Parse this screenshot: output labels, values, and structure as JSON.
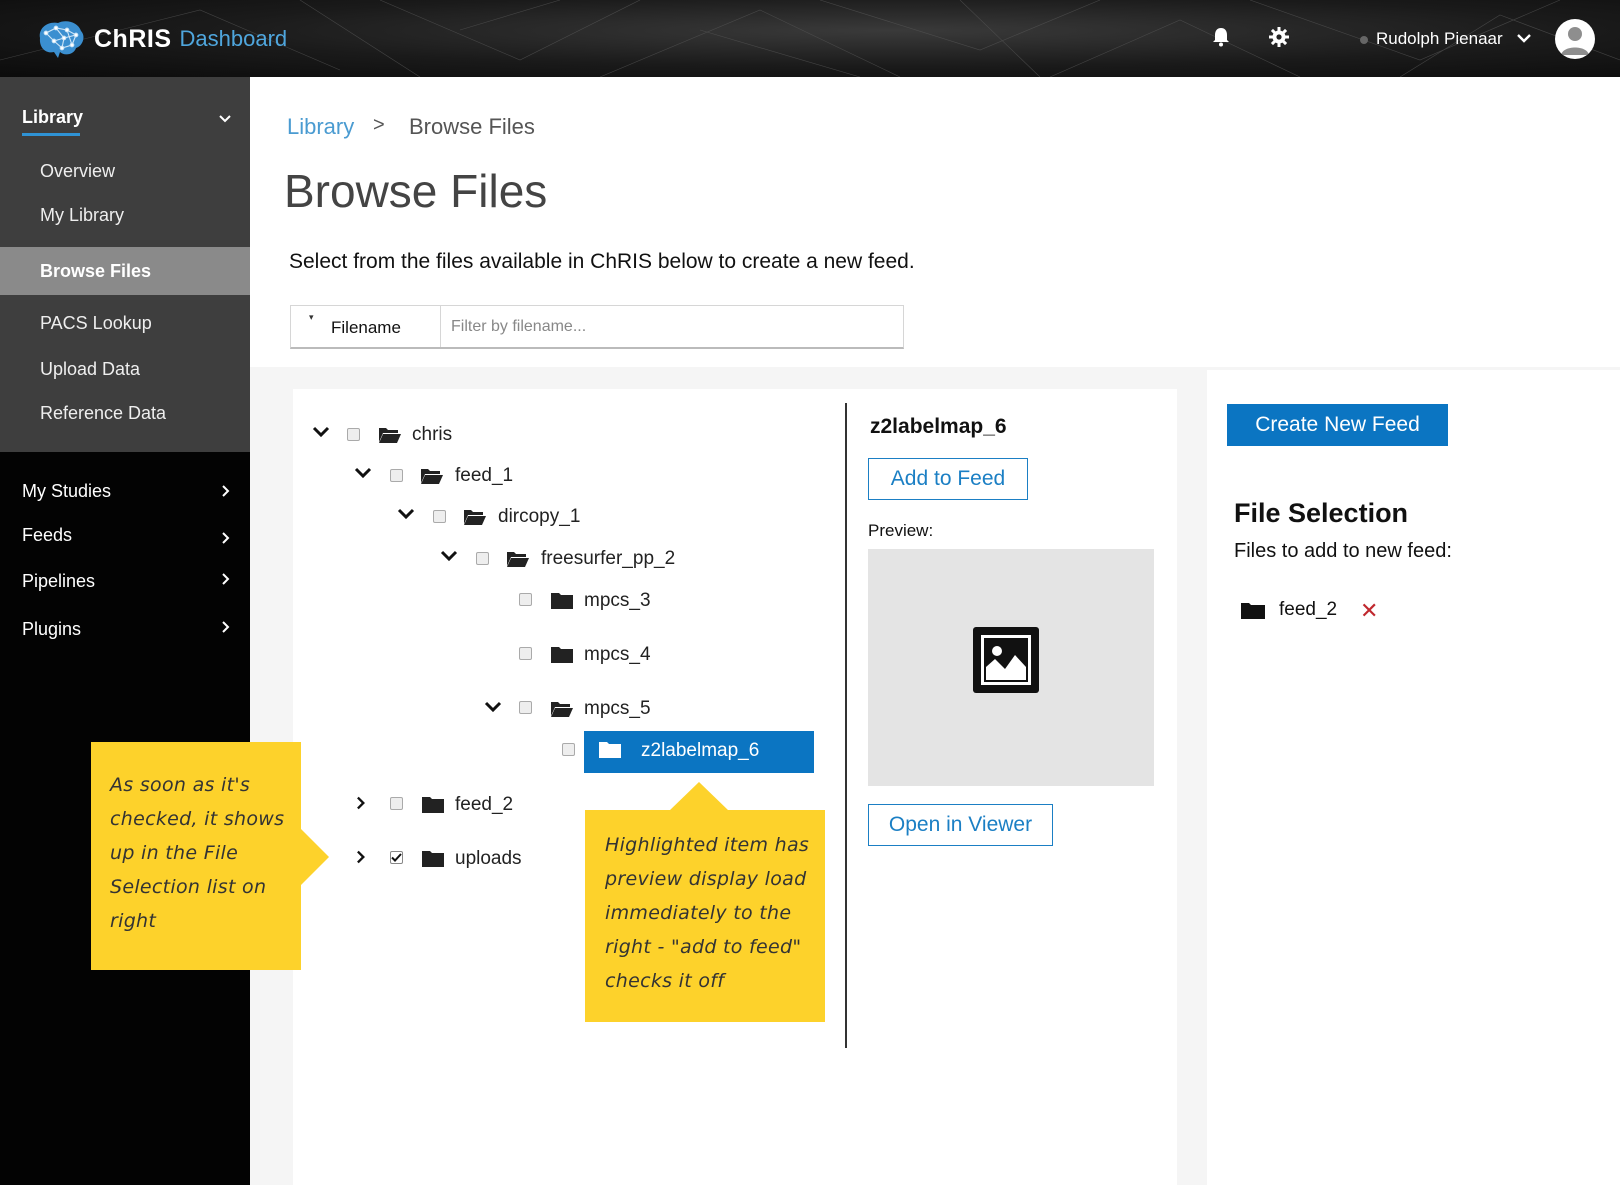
{
  "header": {
    "brand_name": "ChRIS",
    "brand_sub": "Dashboard",
    "user_name": "Rudolph Pienaar",
    "accent_color": "#0b75c2"
  },
  "sidebar": {
    "library_label": "Library",
    "library_items": [
      "Overview",
      "My Library",
      "Browse Files",
      "PACS Lookup",
      "Upload Data",
      "Reference Data"
    ],
    "active_item": "Browse Files",
    "main_items": [
      "My Studies",
      "Feeds",
      "Pipelines",
      "Plugins"
    ]
  },
  "breadcrumb": {
    "parent": "Library",
    "separator": ">",
    "current": "Browse Files"
  },
  "page": {
    "title": "Browse Files",
    "description": "Select from the files available in ChRIS below to create a new feed."
  },
  "filter": {
    "label": "Filename",
    "placeholder": "Filter by filename..."
  },
  "tree": {
    "nodes": [
      {
        "label": "chris",
        "expanded": true,
        "checked": false
      },
      {
        "label": "feed_1",
        "expanded": true,
        "checked": false
      },
      {
        "label": "dircopy_1",
        "expanded": true,
        "checked": false
      },
      {
        "label": "freesurfer_pp_2",
        "expanded": true,
        "checked": false
      },
      {
        "label": "mpcs_3",
        "checked": false
      },
      {
        "label": "mpcs_4",
        "checked": false
      },
      {
        "label": "mpcs_5",
        "expanded": true,
        "checked": false
      },
      {
        "label": "z2labelmap_6",
        "checked": false,
        "highlighted": true
      },
      {
        "label": "feed_2",
        "expanded": false,
        "checked": false
      },
      {
        "label": "uploads",
        "expanded": false,
        "checked": true
      }
    ]
  },
  "preview": {
    "title": "z2labelmap_6",
    "add_button": "Add to Feed",
    "label": "Preview:",
    "open_button": "Open in Viewer"
  },
  "selection": {
    "create_button": "Create New Feed",
    "title": "File Selection",
    "subtitle": "Files to add to new feed:",
    "items": [
      "feed_2"
    ],
    "remove_symbol": "✕"
  },
  "notes": {
    "left": "As soon as it's checked, it shows up in the File Selection list on right",
    "bottom": "Highlighted item has preview display load immediately to the right - \"add to feed\" checks it off"
  }
}
